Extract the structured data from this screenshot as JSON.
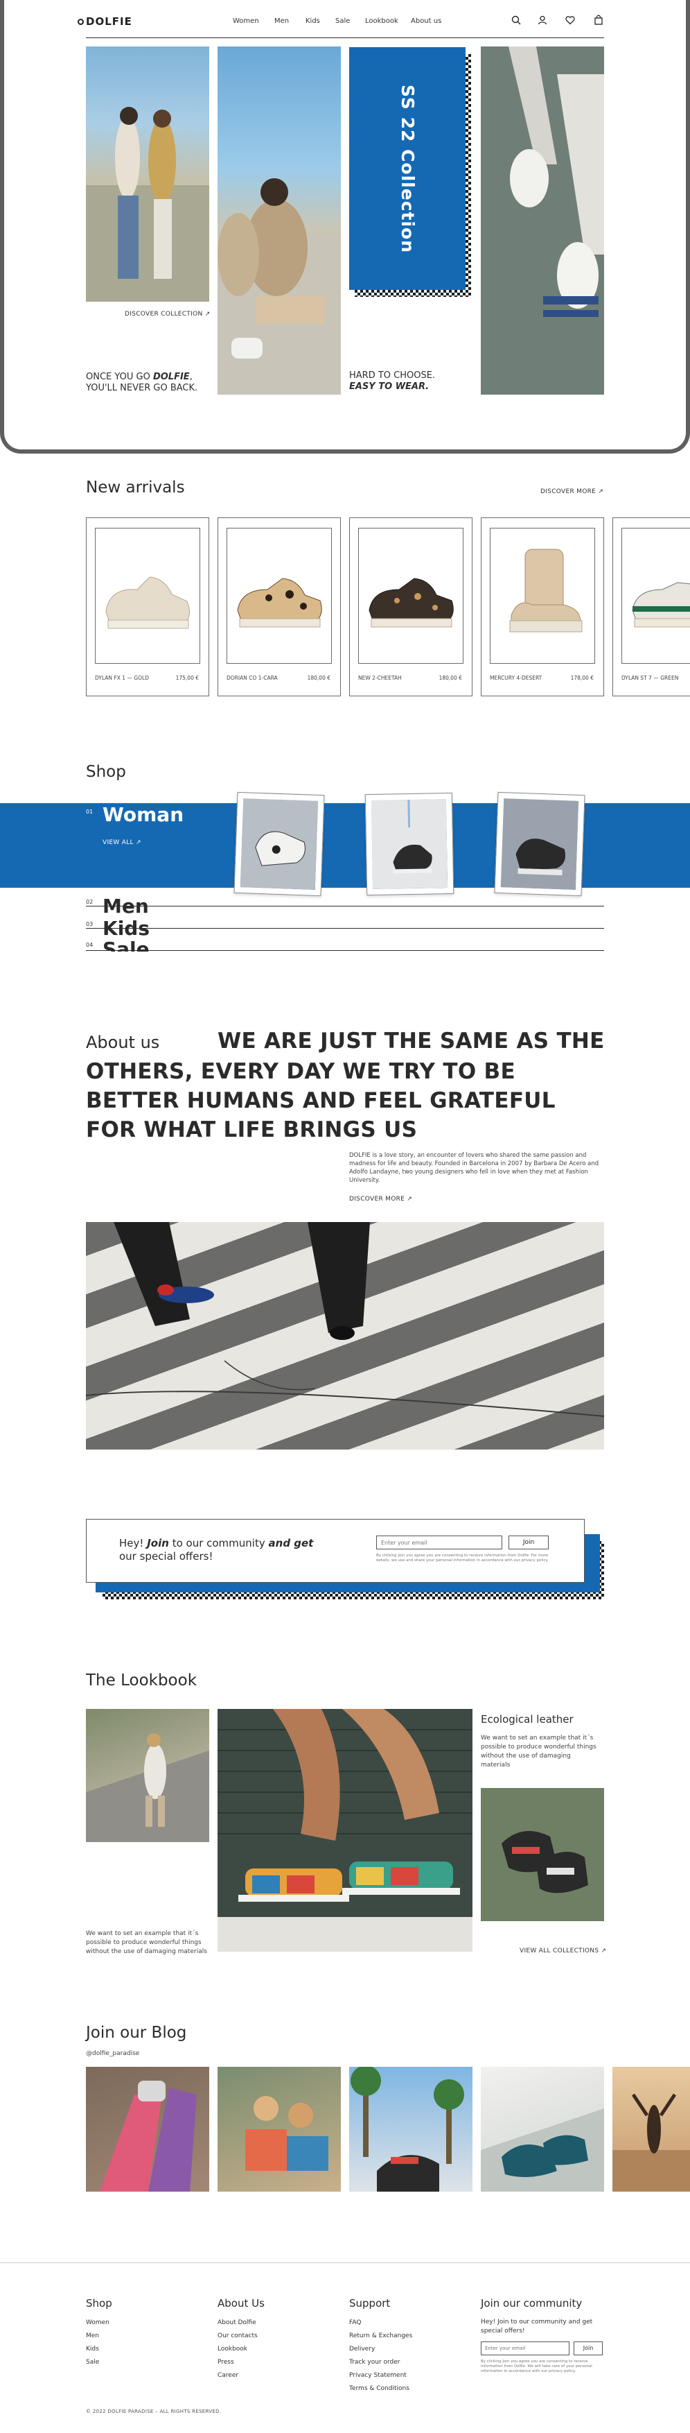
{
  "brand": {
    "logo_text": "DOLFIE"
  },
  "header": {
    "nav": [
      "Women",
      "Men",
      "Kids",
      "Sale",
      "Lookbook",
      "About us"
    ],
    "icons": [
      "search-icon",
      "user-icon",
      "heart-icon",
      "bag-icon"
    ]
  },
  "hero": {
    "discover_label": "DISCOVER COLLECTION",
    "caption_left_1": "ONCE YOU GO",
    "caption_left_brand": "DOLFIE",
    "caption_left_2": "YOU'LL NEVER GO BACK.",
    "collection_label": "SS 22 Collection",
    "caption_right_1": "HARD TO CHOOSE.",
    "caption_right_2": "EASY TO WEAR."
  },
  "new_arrivals": {
    "title": "New arrivals",
    "discover_label": "DISCOVER MORE",
    "products": [
      {
        "name": "DYLAN FX 1 — GOLD",
        "price": "175,00 €"
      },
      {
        "name": "DORIAN CO 1-CARA",
        "price": "180,00 €"
      },
      {
        "name": "NEW 2-CHEETAH",
        "price": "180,00 €"
      },
      {
        "name": "MERCURY 4-DESERT",
        "price": "178,00 €"
      },
      {
        "name": "DYLAN ST 7 — GREEN",
        "price": ""
      }
    ]
  },
  "shop": {
    "title": "Shop",
    "rows": [
      {
        "num": "01",
        "label": "Woman"
      },
      {
        "num": "02",
        "label": "Men"
      },
      {
        "num": "03",
        "label": "Kids"
      },
      {
        "num": "04",
        "label": "Sale"
      }
    ],
    "view_all": "VIEW ALL"
  },
  "about": {
    "label": "About us",
    "heading": "WE ARE JUST THE SAME AS THE OTHERS, EVERY DAY WE TRY TO BE BETTER HUMANS AND FEEL GRATEFUL FOR WHAT LIFE BRINGS US",
    "body": "DOLFIE is a love story, an encounter of lovers who shared the same passion and madness for life and beauty. Founded in Barcelona in 2007 by Barbara De Acero and Adolfo Landayne, two young designers who fell in love when they met at Fashion University.",
    "discover_label": "DISCOVER MORE"
  },
  "newsletter": {
    "text_1": "Hey!",
    "text_join": "Join",
    "text_2": "to our community",
    "text_and": "and get",
    "text_3": "our special offers!",
    "placeholder": "Enter your email",
    "button": "Join",
    "legal": "By clicking Join you agree you are consenting to receive information from Dolfie. For more details, we use and share your personal information in accordance with our privacy policy."
  },
  "lookbook": {
    "title": "The Lookbook",
    "side_title": "Ecological leather",
    "side_text": "We want to set an example that it´s possible to produce wonderful things without the use of damaging materials",
    "bottom_text": "We want to set an example that it´s possible to produce wonderful things without the use of damaging materials",
    "view_all": "VIEW ALL COLLECTIONS"
  },
  "blog": {
    "title": "Join our Blog",
    "handle": "@dolfie_paradise"
  },
  "footer": {
    "shop": {
      "title": "Shop",
      "links": [
        "Women",
        "Men",
        "Kids",
        "Sale"
      ]
    },
    "about": {
      "title": "About Us",
      "links": [
        "About Dolfie",
        "Our contacts",
        "Lookbook",
        "Press",
        "Career"
      ]
    },
    "support": {
      "title": "Support",
      "links": [
        "FAQ",
        "Return & Exchanges",
        "Delivery",
        "Track your order",
        "Privacy Statement",
        "Terms & Conditions"
      ]
    },
    "community": {
      "title": "Join our community",
      "text": "Hey! Join to our community and get special offers!",
      "placeholder": "Enter your email",
      "button": "Join",
      "legal": "By clicking Join you agree you are consenting to receive information from Dolfie. We will take care of your personal information in accordance with our privacy policy."
    },
    "copyright": "© 2022 DOLFIE PARADISE – ALL RIGHTS RESERVED."
  }
}
